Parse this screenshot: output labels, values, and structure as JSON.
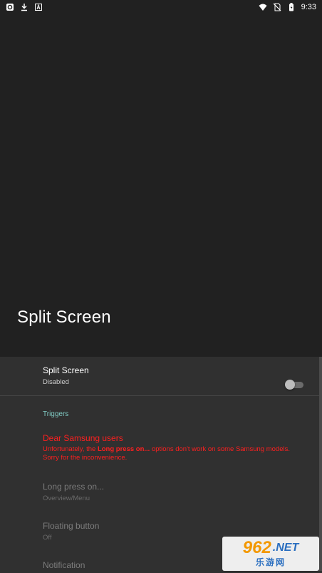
{
  "status_bar": {
    "time": "9:33",
    "left_icons": [
      "app-notification-icon",
      "download-icon",
      "text-icon"
    ],
    "right_icons": [
      "wifi-icon",
      "no-sim-icon",
      "battery-icon"
    ]
  },
  "header": {
    "title": "Split Screen"
  },
  "main_setting": {
    "title": "Split Screen",
    "status": "Disabled",
    "toggle_on": false
  },
  "triggers_section": {
    "label": "Triggers"
  },
  "warning": {
    "title": "Dear Samsung users",
    "text_before": "Unfortunately, the ",
    "text_bold": "Long press on...",
    "text_after": " options don't work on some Samsung models. Sorry for the inconvenience."
  },
  "triggers": [
    {
      "title": "Long press on...",
      "value": "Overview/Menu"
    },
    {
      "title": "Floating button",
      "value": "Off"
    },
    {
      "title": "Notification",
      "value": ""
    }
  ],
  "watermark": {
    "number": "962",
    "suffix": ".NET",
    "chinese": "乐游网"
  },
  "colors": {
    "accent": "#80cbc4",
    "warning": "#ff1f1f",
    "background": "#212121",
    "surface": "#303030"
  }
}
